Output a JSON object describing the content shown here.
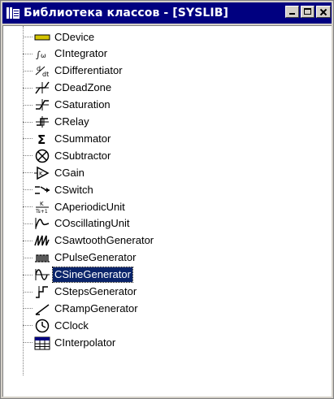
{
  "window": {
    "title": "Библиотека классов - [SYSLIB]"
  },
  "colors": {
    "titlebar": "#000080",
    "selection": "#0a246a",
    "device_icon": "#d4c400"
  },
  "tree": {
    "items": [
      {
        "label": "CDevice",
        "icon": "device-icon"
      },
      {
        "label": "CIntegrator",
        "icon": "integrator-icon"
      },
      {
        "label": "CDifferentiator",
        "icon": "differentiator-icon"
      },
      {
        "label": "CDeadZone",
        "icon": "deadzone-icon"
      },
      {
        "label": "CSaturation",
        "icon": "saturation-icon"
      },
      {
        "label": "CRelay",
        "icon": "relay-icon"
      },
      {
        "label": "CSummator",
        "icon": "sigma-icon"
      },
      {
        "label": "CSubtractor",
        "icon": "subtractor-icon"
      },
      {
        "label": "CGain",
        "icon": "gain-icon"
      },
      {
        "label": "CSwitch",
        "icon": "switch-icon"
      },
      {
        "label": "CAperiodicUnit",
        "icon": "aperiodic-icon"
      },
      {
        "label": "COscillatingUnit",
        "icon": "oscillating-icon"
      },
      {
        "label": "CSawtoothGenerator",
        "icon": "sawtooth-icon"
      },
      {
        "label": "CPulseGenerator",
        "icon": "pulse-icon"
      },
      {
        "label": "CSineGenerator",
        "icon": "sine-icon",
        "selected": true
      },
      {
        "label": "CStepsGenerator",
        "icon": "steps-icon"
      },
      {
        "label": "CRampGenerator",
        "icon": "ramp-icon"
      },
      {
        "label": "CClock",
        "icon": "clock-icon"
      },
      {
        "label": "CInterpolator",
        "icon": "table-icon"
      }
    ],
    "aperiodic_icon_text": {
      "num": "K",
      "den": "Ts+1"
    }
  }
}
